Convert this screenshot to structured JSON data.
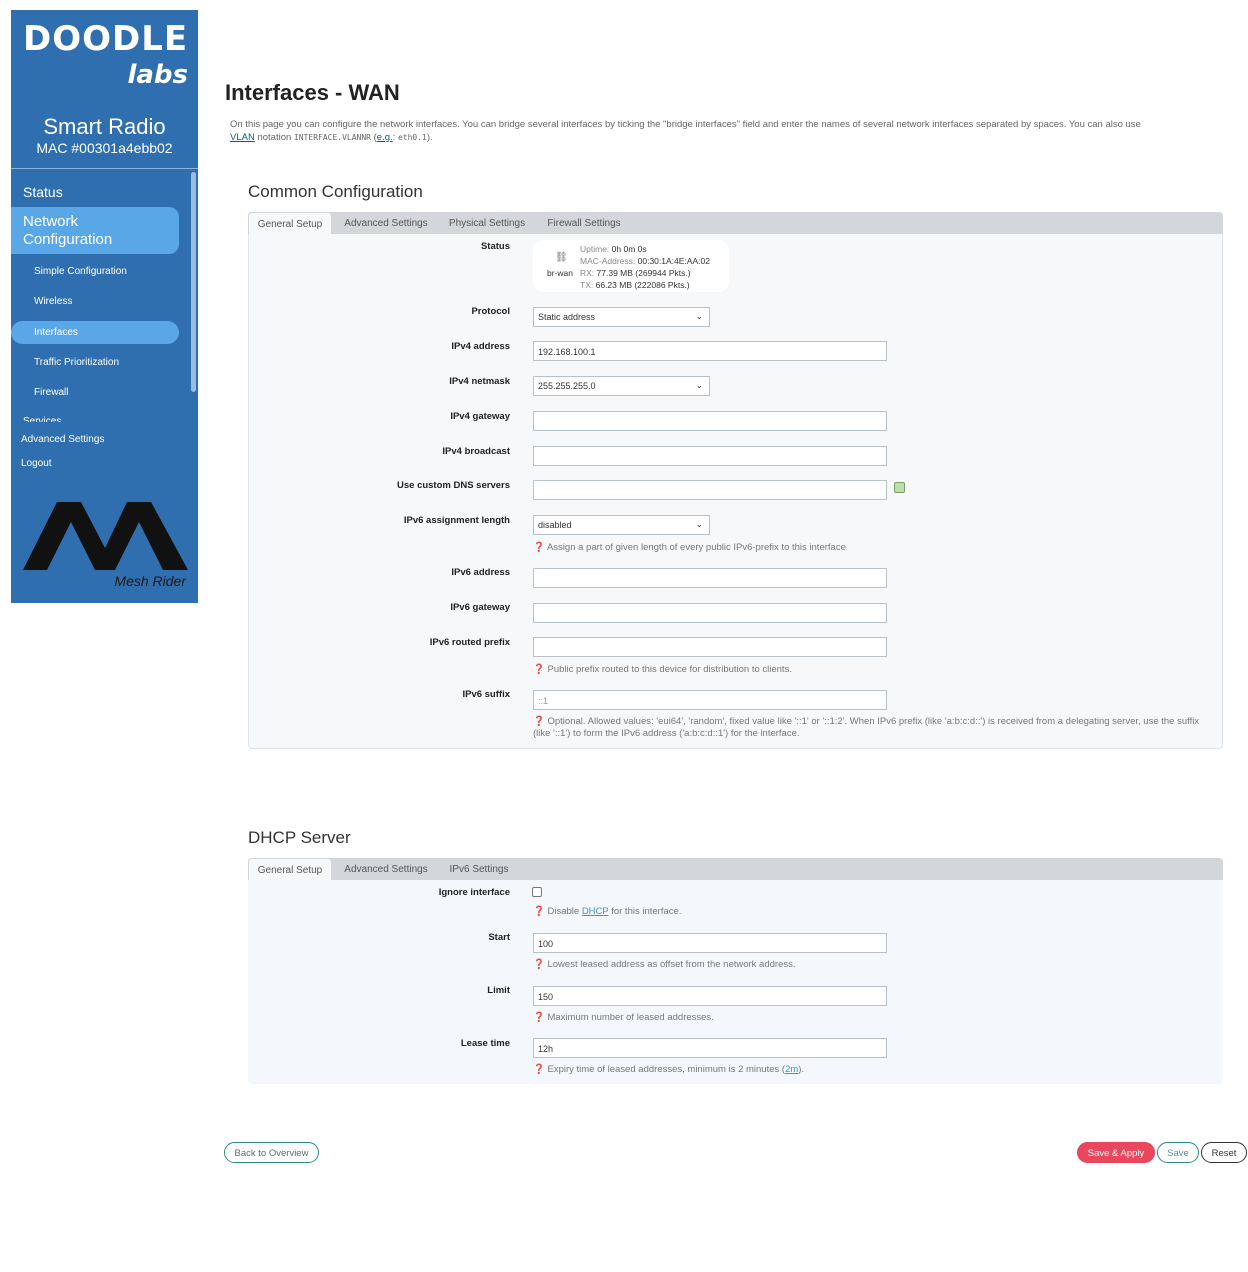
{
  "sidebar": {
    "logo_main": "DOODLE",
    "logo_sub": "labs",
    "device_name": "Smart Radio",
    "device_mac": "MAC #00301a4ebb02",
    "status": "Status",
    "network_configuration": "Network Configuration",
    "items": [
      {
        "label": "Simple Configuration"
      },
      {
        "label": "Wireless"
      },
      {
        "label": "Interfaces",
        "active": true
      },
      {
        "label": "Traffic Prioritization"
      },
      {
        "label": "Firewall"
      }
    ],
    "partial_item": "Services",
    "advanced_settings": "Advanced Settings",
    "logout": "Logout",
    "brand_text": "Mesh Rider"
  },
  "page": {
    "title": "Interfaces - WAN",
    "desc_part1": "On this page you can configure the network interfaces. You can bridge several interfaces by ticking the \"bridge interfaces\" field and enter the names of several network interfaces separated by spaces. You can also use",
    "desc_vlan": "VLAN",
    "desc_part2": "notation",
    "desc_code1": "INTERFACE.VLANNR",
    "desc_eg": "e.g.",
    "desc_code2": "eth0.1"
  },
  "common": {
    "title": "Common Configuration",
    "tabs": [
      "General Setup",
      "Advanced Settings",
      "Physical Settings",
      "Firewall Settings"
    ],
    "status_label": "Status",
    "status": {
      "device": "br-wan",
      "uptime_key": "Uptime:",
      "uptime": "0h 0m 0s",
      "mac_key": "MAC-Address:",
      "mac": "00:30:1A:4E:AA:02",
      "rx_key": "RX:",
      "rx": "77.39 MB (269944 Pkts.)",
      "tx_key": "TX:",
      "tx": "66.23 MB (222086 Pkts.)"
    },
    "protocol_label": "Protocol",
    "protocol_value": "Static address",
    "ipv4_address_label": "IPv4 address",
    "ipv4_address_value": "192.168.100.1",
    "ipv4_netmask_label": "IPv4 netmask",
    "ipv4_netmask_value": "255.255.255.0",
    "ipv4_gateway_label": "IPv4 gateway",
    "ipv4_broadcast_label": "IPv4 broadcast",
    "dns_label": "Use custom DNS servers",
    "ipv6_assign_label": "IPv6 assignment length",
    "ipv6_assign_value": "disabled",
    "ipv6_assign_hint": "Assign a part of given length of every public IPv6-prefix to this interface",
    "ipv6_address_label": "IPv6 address",
    "ipv6_gateway_label": "IPv6 gateway",
    "ipv6_routed_label": "IPv6 routed prefix",
    "ipv6_routed_hint": "Public prefix routed to this device for distribution to clients.",
    "ipv6_suffix_label": "IPv6 suffix",
    "ipv6_suffix_placeholder": "::1",
    "ipv6_suffix_hint": "Optional. Allowed values: 'eui64', 'random', fixed value like '::1' or '::1:2'. When IPv6 prefix (like 'a:b:c:d::') is received from a delegating server, use the suffix (like '::1') to form the IPv6 address ('a:b:c:d::1') for the interface."
  },
  "dhcp": {
    "title": "DHCP Server",
    "tabs": [
      "General Setup",
      "Advanced Settings",
      "IPv6 Settings"
    ],
    "ignore_label": "Ignore interface",
    "ignore_hint_pre": "Disable",
    "ignore_hint_link": "DHCP",
    "ignore_hint_post": "for this interface.",
    "start_label": "Start",
    "start_value": "100",
    "start_hint": "Lowest leased address as offset from the network address.",
    "limit_label": "Limit",
    "limit_value": "150",
    "limit_hint": "Maximum number of leased addresses.",
    "lease_label": "Lease time",
    "lease_value": "12h",
    "lease_hint_pre": "Expiry time of leased addresses, minimum is 2 minutes (",
    "lease_hint_code": "2m",
    "lease_hint_post": ")."
  },
  "buttons": {
    "back": "Back to Overview",
    "save_apply": "Save & Apply",
    "save": "Save",
    "reset": "Reset"
  },
  "colors": {
    "sidebar": "#2f6fb0",
    "sidebar_active": "#5aa7e8",
    "save_apply": "#e8475d"
  }
}
